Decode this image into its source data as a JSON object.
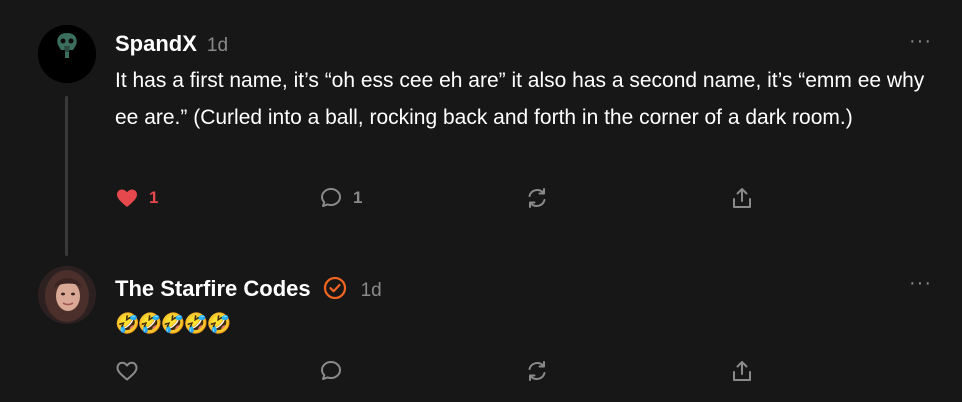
{
  "comments": [
    {
      "author": "SpandX",
      "time": "1d",
      "text": "It has a first name, it’s “oh ess cee eh are” it also has a second name, it’s “emm ee why ee are.” (Curled into a ball, rocking back and forth in the corner of a dark room.)",
      "likes": "1",
      "replies": "1",
      "liked": true
    },
    {
      "author": "The Starfire Codes",
      "time": "1d",
      "text": "🤣🤣🤣🤣🤣",
      "verified": true
    }
  ],
  "more_label": "···",
  "colors": {
    "like_red": "#e5484d",
    "verified_orange": "#f26522",
    "muted": "#8a8a8a"
  }
}
